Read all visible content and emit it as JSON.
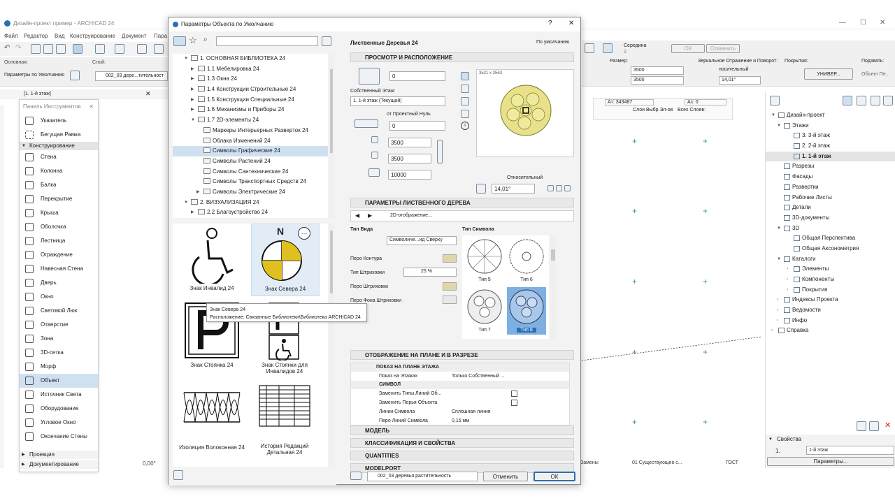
{
  "app": {
    "title": "Дизайн-проект пример - ARCHICAD 24",
    "menu": [
      "Файл",
      "Редактор",
      "Вид",
      "Конструирование",
      "Документ",
      "Пара"
    ],
    "info_labels": {
      "main": "Основная:",
      "layer": "Слой:",
      "default_params": "Параметры по Умолчанию",
      "layer_value": "002_03 дере...тительност"
    },
    "right_info": {
      "middle_label": "Середина",
      "middle_num": "2",
      "ok": "ОК",
      "cancel": "Отменить",
      "size_label": "Размер:",
      "size_a": "3500",
      "size_b": "3500",
      "mirror_label": "Зеркальное Отражение и Поворот:",
      "mirror_value": "носительный",
      "angle_value": "14,01°",
      "cover_label": "Покрытия:",
      "cover_value": "УНИВЕР...",
      "subst_label": "Подзвать:",
      "subst_value": "Объект Пе...",
      "a_label": "Aт: 343487",
      "b_label": "Аз: 0",
      "layers_label": "Слои Выбр.Эл-ов",
      "all_layers_label": "Всех Слоев:"
    },
    "tab": "[1. 1-й этаж]",
    "bottom": {
      "angle": "0,00°",
      "zamen": "Замены",
      "existing": "01 Существующее с...",
      "gost": "ГОСТ"
    }
  },
  "toolbox": {
    "title": "Панель Инструментов",
    "items": [
      {
        "label": "Указатель"
      },
      {
        "label": "Бегущая Рамка"
      }
    ],
    "section": "Конструирование",
    "tools": [
      "Стена",
      "Колонна",
      "Балка",
      "Перекрытие",
      "Крыша",
      "Оболочка",
      "Лестница",
      "Ограждение",
      "Навесная Стена",
      "Дверь",
      "Окно",
      "Световой Люк",
      "Отверстие",
      "Зона",
      "3D-сетка",
      "Морф",
      "Объект",
      "Источник Света",
      "Оборудование",
      "Угловое Окно",
      "Окончание Стены"
    ],
    "bottom_sections": [
      "Проекция",
      "Документирование"
    ]
  },
  "dialog": {
    "title": "Параметры Объекта по Умолчанию",
    "help": "?",
    "close": "✕",
    "search_placeholder": "",
    "tree": [
      "1. ОСНОВНАЯ БИБЛИОТЕКА 24",
      "1.1 Мебелировка 24",
      "1.3 Окна 24",
      "1.4 Конструкции Строительные 24",
      "1.5 Конструкции Специальные 24",
      "1.6 Механизмы и Приборы 24",
      "1.7 2D-элементы 24",
      "Маркеры Интерьерных Разверток 24",
      "Облака Изменений 24",
      "Символы Графические 24",
      "Символы Растений 24",
      "Символы Сантехнические 24",
      "Символы Транспортных Средств 24",
      "Символы Электрические 24",
      "2. ВИЗУАЛИЗАЦИЯ 24",
      "2.2 Благоустройство 24"
    ],
    "thumbs": [
      {
        "label": "Знак Инвалид 24"
      },
      {
        "label": "Знак Севера 24"
      },
      {
        "label": "Знак Стоянка 24"
      },
      {
        "label": "Знак Стоянки для Инвалидов 24"
      },
      {
        "label": "Изоляция Волоконная 24"
      },
      {
        "label": "История Редакций Детальная 24"
      }
    ],
    "north_letter": "N",
    "tooltip": {
      "title": "Знак Севера 24",
      "location": "Расположение: Связанные Библиотеки\\Библиотека ARCHICAD 24"
    },
    "right": {
      "object_name": "Лиственные Деревья 24",
      "default": "По умолчанию",
      "sec_view": "ПРОСМОТР И РАСПОЛОЖЕНИЕ",
      "val0": "0",
      "own_floor_label": "Собственный Этаж:",
      "floor_value": "1. 1-й этаж (Текущий)",
      "from_zero": "от Проектный Нуль",
      "val_zero": "0",
      "w": "3500",
      "h": "3500",
      "d": "10000",
      "preview_label": "3521 х 3563",
      "relative": "Относительный",
      "angle": "14,01°",
      "sec_tree": "ПАРАМЕТРЫ ЛИСТВЕННОГО ДЕРЕВА",
      "view_2d": "2D-отображение...",
      "type_view": "Тип Вида",
      "type_symbol": "Тип Символа",
      "symbol_value": "Символиче...ид Сверху",
      "contour_pen": "Перо Контура",
      "hatch_type": "Тип Штриховки",
      "hatch_value": "25 %",
      "hatch_pen": "Перо Штриховки",
      "hatch_bg_pen": "Перо Фона Штриховки",
      "symbols": [
        "Тип 5",
        "Тип 6",
        "Тип 7",
        "Тип 8"
      ],
      "sec_plan": "ОТОБРАЖЕНИЕ НА ПЛАНЕ И В РАЗРЕЗЕ",
      "show_on_plan": "ПОКАЗ НА ПЛАНЕ ЭТАЖА",
      "show_on_floors": "Показ на Этажах",
      "show_on_floors_value": "Только Собственный ...",
      "symbol_header": "СИМВОЛ",
      "replace_line": "Заменить Типы Линий Об...",
      "replace_pen": "Заменить Перья Объекта",
      "symbol_lines": "Линии Символа",
      "symbol_lines_value": "Сплошная линия",
      "symbol_pen": "Перо Линий Символа",
      "symbol_pen_value": "0,15 мм",
      "sec_model": "МОДЕЛЬ",
      "sec_class": "КЛАССИФИКАЦИЯ И СВОЙСТВА",
      "sec_quant": "QUANTITIES",
      "sec_modelport": "MODELPORT"
    },
    "footer": {
      "layer": "002_03 деревья растительность",
      "cancel": "Отменить",
      "ok": "ОК"
    }
  },
  "navigator": {
    "items": [
      "Дизайн-проект",
      "Этажи",
      "3. 3-й этаж",
      "2. 2-й этаж",
      "1. 1-й этаж",
      "Разрезы",
      "Фасады",
      "Развертки",
      "Рабочие Листы",
      "Детали",
      "3D-документы",
      "3D",
      "Общая Перспектива",
      "Общая Аксонометрия",
      "Каталоги",
      "Элементы",
      "Компоненты",
      "Покрытия",
      "Индексы Проекта",
      "Ведомости",
      "Инфо",
      "Справка"
    ],
    "props_title": "Свойства",
    "props_num": "1.",
    "props_value": "1-й этаж",
    "props_button": "Параметры..."
  }
}
